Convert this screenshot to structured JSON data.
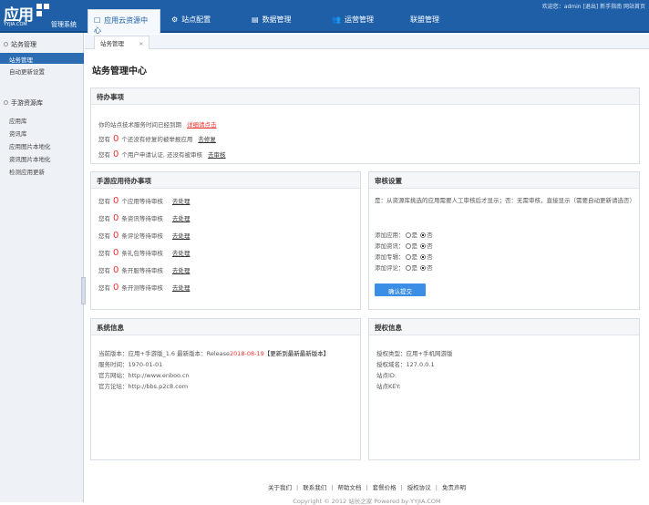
{
  "header": {
    "logo_big": "应用",
    "logo_domain": "YYJIA.COM",
    "logo_sys": "管理系统",
    "welcome": "欢迎您：admin [退出] 新手指南 网站首页",
    "nav": [
      {
        "label": "应用云资源中心",
        "icon": "☐"
      },
      {
        "label": "站点配置",
        "icon": "⚙"
      },
      {
        "label": "数据管理",
        "icon": "▤"
      },
      {
        "label": "运营管理",
        "icon": "👥"
      },
      {
        "label": "联盟管理",
        "icon": ""
      }
    ]
  },
  "sidebar": {
    "groups": [
      {
        "label": "站务管理",
        "items": [
          "站务管理",
          "自动更新设置"
        ]
      },
      {
        "label": "手游资源库",
        "items": [
          "应用库",
          "资讯库",
          "应用图片本地化",
          "资讯图片本地化",
          "检测应用更新"
        ]
      }
    ]
  },
  "tab": {
    "label": "站务管理",
    "close": "×"
  },
  "page_title": "站务管理中心",
  "todo": {
    "title": "待办事项",
    "l1": "你的站点技术服务时间已经到期",
    "l1_link": "详细请点击",
    "l2a": "您有",
    "l2n": "0",
    "l2b": "个还没有修复的被举报应用",
    "l2_link": "去修复",
    "l3a": "您有",
    "l3n": "0",
    "l3b": "个用户申请认证, 还没有被审核",
    "l3_link": "去审核"
  },
  "mobile": {
    "title": "手游应用待办事项",
    "rows": [
      {
        "a": "您有",
        "n": "0",
        "b": "个应用等待审核",
        "link": "去处理"
      },
      {
        "a": "您有",
        "n": "0",
        "b": "条资讯等待审核",
        "link": "去处理"
      },
      {
        "a": "您有",
        "n": "0",
        "b": "条评论等待审核",
        "link": "去处理"
      },
      {
        "a": "您有",
        "n": "0",
        "b": "条礼包等待审核",
        "link": "去处理"
      },
      {
        "a": "您有",
        "n": "0",
        "b": "条开服等待审核",
        "link": "去处理"
      },
      {
        "a": "您有",
        "n": "0",
        "b": "条开测等待审核",
        "link": "去处理"
      }
    ]
  },
  "audit": {
    "title": "审核设置",
    "desc": "是：从资源库挑选的应用需要人工审核后才显示；否：无需审核，直接显示（需要自动更新请选否）",
    "rows": [
      {
        "label": "添加应用：",
        "yes": "是",
        "no": "否"
      },
      {
        "label": "添加资讯：",
        "yes": "是",
        "no": "否"
      },
      {
        "label": "添加专辑：",
        "yes": "是",
        "no": "否"
      },
      {
        "label": "添加评论：",
        "yes": "是",
        "no": "否"
      }
    ],
    "submit": "确认提交"
  },
  "sysinfo": {
    "title": "系统信息",
    "version_a": "当前版本：应用+手游版_1.6 最新版本：Release",
    "version_date": "2018-08-19",
    "version_b": "【更新到最新最新版本】",
    "service": "服务时间：1970-01-01",
    "site": "官方网站：http://www.enboo.cn",
    "forum": "官方论坛：http://bbs.p2c8.com"
  },
  "auth": {
    "title": "授权信息",
    "type": "授权类型：应用+手机网游版",
    "domain": "授权域名：127.0.0.1",
    "siteid": "站点ID:",
    "sitekey": "站点KEY:"
  },
  "footer": {
    "links": [
      "关于我们",
      "联系我们",
      "帮助文档",
      "套餐价格",
      "授权协议",
      "免责声明"
    ],
    "copy": "Copyright © 2012 站长之家 Powered by YYJIA.COM"
  }
}
